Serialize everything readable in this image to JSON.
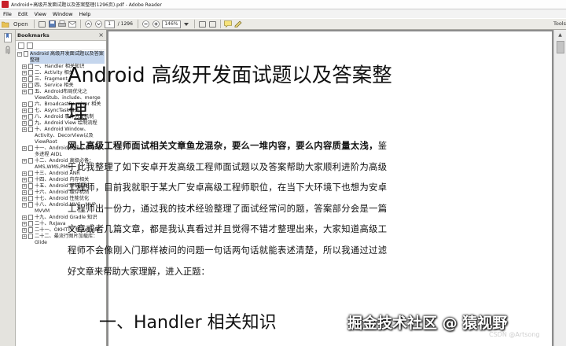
{
  "window": {
    "title": "Android+高级开发面试题以及答案整理(1296页).pdf - Adobe Reader"
  },
  "menubar": {
    "items": [
      "File",
      "Edit",
      "View",
      "Window",
      "Help"
    ]
  },
  "toolbar": {
    "open_label": "Open",
    "page_current": "1",
    "page_count": "/ 1296",
    "zoom": "146%",
    "tools_label": "Tools"
  },
  "bookmarks": {
    "title": "Bookmarks",
    "root": "Android 高级开发面试题以及答案整理",
    "items": [
      "一、Handler 相关知识",
      "二、Activity 相关",
      "三、Fragment",
      "四、Service 相关",
      "五、Android布局优化之ViewStub、include、merge",
      "六、BroadcastReceiver 相关",
      "七、AsyncTask相关",
      "八、Android 事件分发机制",
      "九、Android View 绘制流程",
      "十、Android Window、Activity、DecorView以及ViewRoot",
      "十一、Android 的核心 Binder 多进程 AIDL",
      "十二、Android 高级必备：AMS,WMS,PMS",
      "十三、Android ANR",
      "十四、Android 内存相关",
      "十五、Android 屏幕适配",
      "十六、Android 缓存机制",
      "十七、Android 性能优化",
      "十八、Android MVC、MVP、MVVM",
      "十九、Android Gradle 知识",
      "二十、RxJava",
      "二十一、OKHTTP 和 Retrofit",
      "二十二、最流行图片加载库：Glide"
    ]
  },
  "document": {
    "title": "Android  高级开发面试题以及答案整理",
    "intro_bold": "网上高级工程师面试相关文章鱼龙混杂，要么一堆内容，要么内容质量太浅，",
    "intro_rest": "鉴于此我整理了如下安卓开发高级工程师面试题以及答案帮助大家顺利进阶为高级工程师，目前我就职于某大厂安卓高级工程师职位，在当下大环境下也想为安卓工程师出一份力，通过我的技术经验整理了面试经常问的题，答案部分会是一篇文章或者几篇文章，都是我认真看过并且觉得不错才整理出来，大家知道高级工程师不会像刚入门那样被问的问题一句话两句话就能表述清楚，所以我通过过滤好文章来帮助大家理解，进入正题：",
    "next_heading": "一、Handler 相关知识"
  },
  "overlay": {
    "watermark": "掘金技术社区 @ 猿视野",
    "csdn": "CSDN @Artsong"
  },
  "colors": {
    "selection": "#c5d6ed",
    "doc_background": "#8c8c8c",
    "title_icon": "#c8202a"
  }
}
